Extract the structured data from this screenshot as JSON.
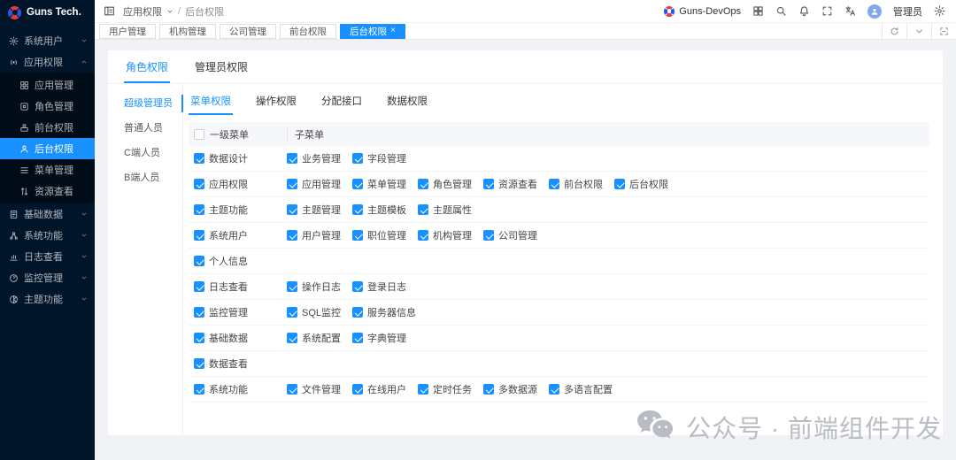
{
  "colors": {
    "accent": "#1890ff",
    "sidebar_bg": "#001529",
    "submenu_bg": "#000c17",
    "page_bg": "#f0f2f5"
  },
  "sidebar": {
    "logo": "Guns Tech.",
    "menu": [
      {
        "label": "系统用户",
        "icon": "gear-icon",
        "chevron": "down"
      },
      {
        "label": "应用权限",
        "icon": "broadcast-icon",
        "chevron": "up",
        "expanded": true,
        "children": [
          {
            "label": "应用管理",
            "icon": "apps-icon"
          },
          {
            "label": "角色管理",
            "icon": "role-icon"
          },
          {
            "label": "前台权限",
            "icon": "frontend-icon"
          },
          {
            "label": "后台权限",
            "icon": "user-icon",
            "active": true
          },
          {
            "label": "菜单管理",
            "icon": "menu-lines-icon"
          },
          {
            "label": "资源查看",
            "icon": "arrows-icon"
          }
        ]
      },
      {
        "label": "基础数据",
        "icon": "document-icon",
        "chevron": "down"
      },
      {
        "label": "系统功能",
        "icon": "cluster-icon",
        "chevron": "down"
      },
      {
        "label": "日志查看",
        "icon": "chart-icon",
        "chevron": "down"
      },
      {
        "label": "监控管理",
        "icon": "monitor-icon",
        "chevron": "down"
      },
      {
        "label": "主题功能",
        "icon": "theme-icon",
        "chevron": "down"
      }
    ]
  },
  "topbar": {
    "breadcrumb": {
      "first": "应用权限",
      "separator": "/",
      "current": "后台权限"
    },
    "brand": "Guns-DevOps",
    "user": "管理员"
  },
  "tabbar": {
    "tabs": [
      {
        "label": "用户管理"
      },
      {
        "label": "机构管理"
      },
      {
        "label": "公司管理"
      },
      {
        "label": "前台权限"
      },
      {
        "label": "后台权限",
        "active": true,
        "close": "×"
      }
    ]
  },
  "panel": {
    "tabs": [
      {
        "label": "角色权限",
        "active": true
      },
      {
        "label": "管理员权限"
      }
    ],
    "roles": [
      {
        "label": "超级管理员",
        "active": true
      },
      {
        "label": "普通人员"
      },
      {
        "label": "C端人员"
      },
      {
        "label": "B端人员"
      }
    ],
    "perm_tabs": [
      {
        "label": "菜单权限",
        "active": true
      },
      {
        "label": "操作权限"
      },
      {
        "label": "分配接口"
      },
      {
        "label": "数据权限"
      }
    ],
    "table": {
      "col1_header": "一级菜单",
      "col2_header": "子菜单",
      "header_checkbox_checked": false,
      "rows": [
        {
          "menu": "数据设计",
          "checked": true,
          "children": [
            "业务管理",
            "字段管理"
          ]
        },
        {
          "menu": "应用权限",
          "checked": true,
          "children": [
            "应用管理",
            "菜单管理",
            "角色管理",
            "资源查看",
            "前台权限",
            "后台权限"
          ]
        },
        {
          "menu": "主题功能",
          "checked": true,
          "children": [
            "主题管理",
            "主题模板",
            "主题属性"
          ]
        },
        {
          "menu": "系统用户",
          "checked": true,
          "children": [
            "用户管理",
            "职位管理",
            "机构管理",
            "公司管理"
          ]
        },
        {
          "menu": "个人信息",
          "checked": true,
          "children": []
        },
        {
          "menu": "日志查看",
          "checked": true,
          "children": [
            "操作日志",
            "登录日志"
          ]
        },
        {
          "menu": "监控管理",
          "checked": true,
          "children": [
            "SQL监控",
            "服务器信息"
          ]
        },
        {
          "menu": "基础数据",
          "checked": true,
          "children": [
            "系统配置",
            "字典管理"
          ]
        },
        {
          "menu": "数据查看",
          "checked": true,
          "children": []
        },
        {
          "menu": "系统功能",
          "checked": true,
          "children": [
            "文件管理",
            "在线用户",
            "定时任务",
            "多数据源",
            "多语言配置"
          ]
        }
      ]
    }
  },
  "watermark": {
    "text": "公众号 · 前端组件开发"
  }
}
